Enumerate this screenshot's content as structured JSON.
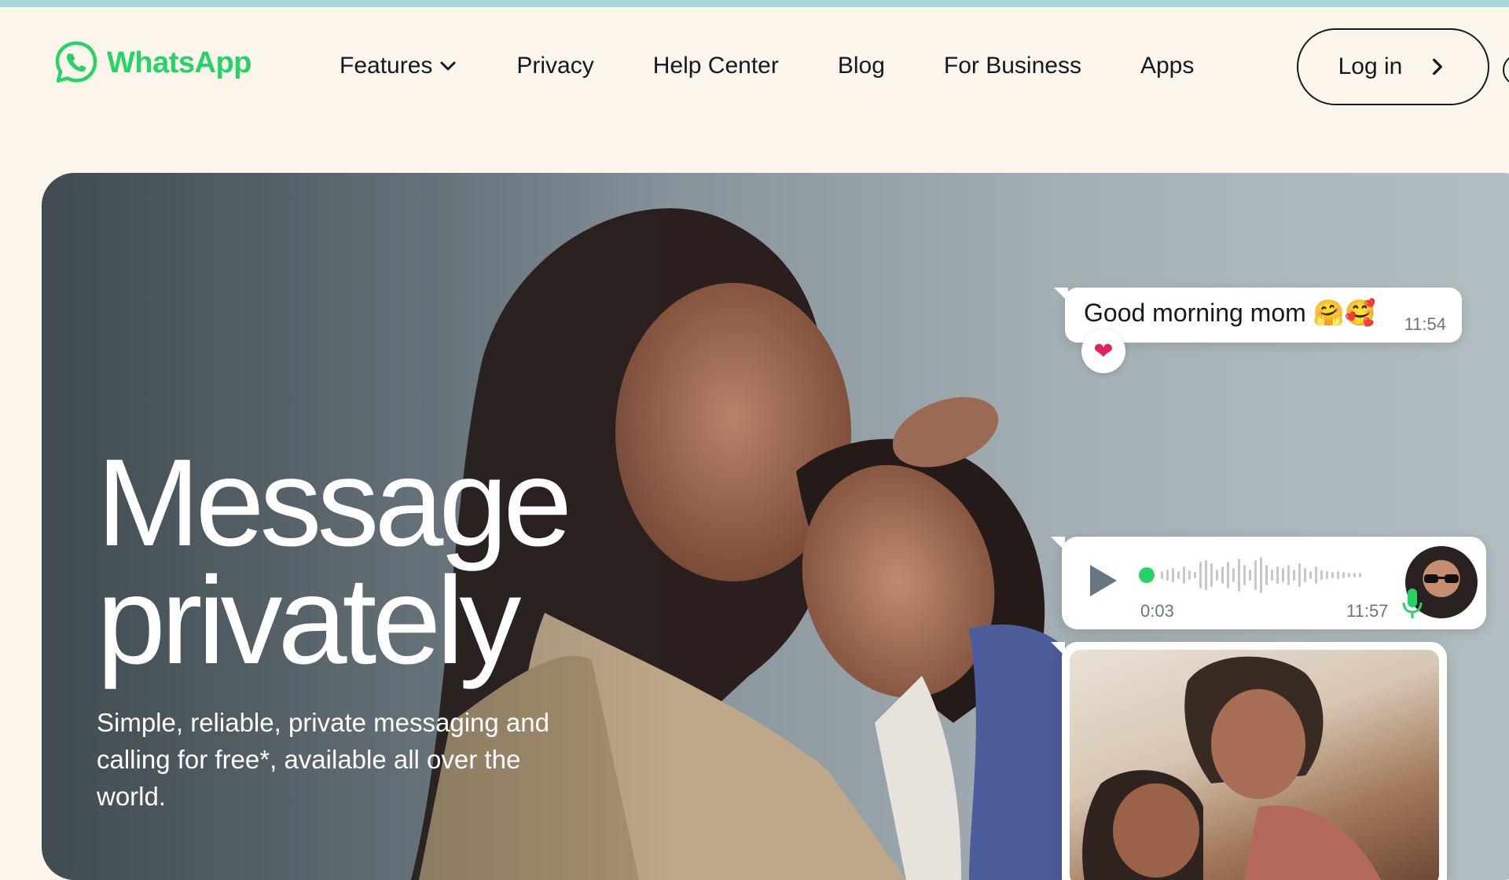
{
  "brand": {
    "name": "WhatsApp",
    "color": "#25d366",
    "icon": "whatsapp-logo-icon"
  },
  "nav": {
    "items": [
      {
        "label": "Features",
        "has_dropdown": true
      },
      {
        "label": "Privacy"
      },
      {
        "label": "Help Center"
      },
      {
        "label": "Blog"
      },
      {
        "label": "For Business"
      },
      {
        "label": "Apps"
      }
    ],
    "login_label": "Log in"
  },
  "hero": {
    "headline_line1": "Message",
    "headline_line2": "privately",
    "subtext": "Simple, reliable, private messaging and calling for free*, available all over the world."
  },
  "chat": {
    "message_text": "Good morning mom 🤗🥰",
    "message_time": "11:54",
    "reaction": "❤",
    "voice_note": {
      "duration": "0:03",
      "time": "11:57",
      "progress": 0.0
    }
  },
  "colors": {
    "background": "#fcf5eb",
    "text": "#111b21",
    "accent": "#25d366"
  }
}
